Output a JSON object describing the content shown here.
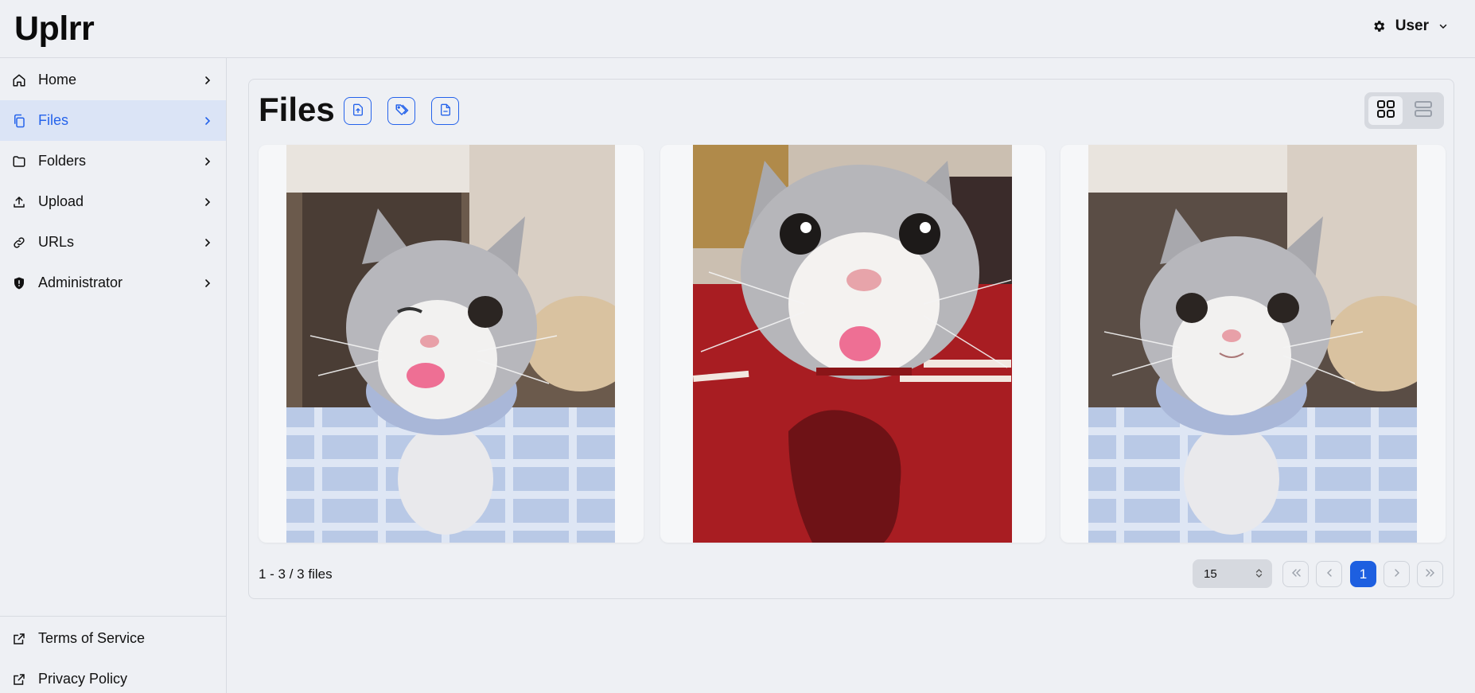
{
  "app": {
    "brand": "Uplrr"
  },
  "header": {
    "user_label": "User",
    "user_icon": "gear-icon",
    "menu_icon": "chevron-down-icon"
  },
  "sidebar": {
    "items": [
      {
        "label": "Home",
        "icon": "home-icon"
      },
      {
        "label": "Files",
        "icon": "files-icon",
        "active": true
      },
      {
        "label": "Folders",
        "icon": "folder-icon"
      },
      {
        "label": "Upload",
        "icon": "upload-icon"
      },
      {
        "label": "URLs",
        "icon": "link-icon"
      },
      {
        "label": "Administrator",
        "icon": "shield-icon"
      }
    ],
    "footer_links": [
      {
        "label": "Terms of Service",
        "icon": "external-link-icon"
      },
      {
        "label": "Privacy Policy",
        "icon": "external-link-icon"
      }
    ]
  },
  "main": {
    "title": "Files",
    "actions": [
      "upload-file-icon",
      "tags-icon",
      "file-icon"
    ],
    "view_modes": [
      "grid-view-icon",
      "list-view-icon"
    ],
    "active_view": "grid",
    "files": [
      {
        "image": "gray-white kitten winking with tongue out"
      },
      {
        "image": "gray-white kitten close-up with tongue out on red rug"
      },
      {
        "image": "gray-white kitten sitting on checkered blanket"
      }
    ],
    "count_text": "1 - 3 / 3 files",
    "per_page": "15",
    "current_page": "1"
  },
  "colors": {
    "accent": "#2563eb",
    "active_nav_bg": "#dbe4f6",
    "page_bg": "#eef0f4"
  }
}
